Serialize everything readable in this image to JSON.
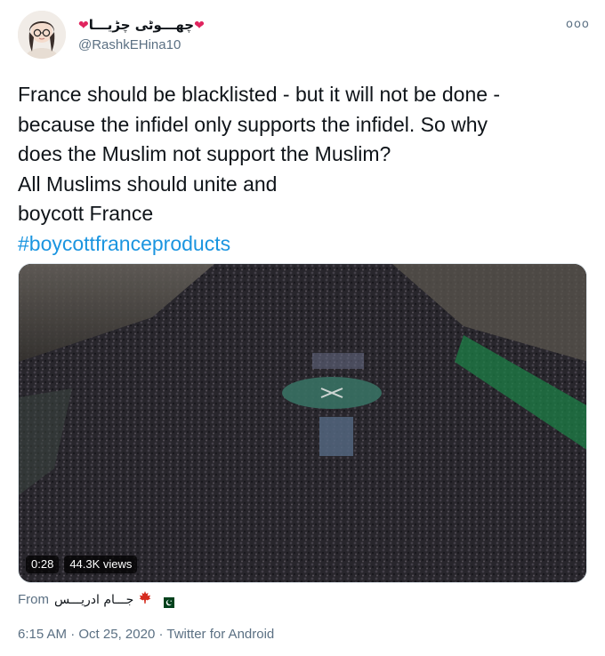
{
  "author": {
    "display_name": "چھـــوٹی چڑیـــا",
    "heart_left": "❤",
    "heart_right": "❤",
    "handle": "@RashkEHina10"
  },
  "more_label": "ooo",
  "tweet": {
    "lines": [
      "France should be blacklisted - but it will not be done -",
      "because the infidel only supports the infidel. So why",
      "does the Muslim not support the Muslim?",
      "All Muslims should unite and",
      "boycott France"
    ],
    "hashtag": "#boycottfranceproducts"
  },
  "media": {
    "duration": "0:28",
    "views": "44.3K views"
  },
  "from": {
    "label": "From",
    "source_name": "جـــام ادریـــس",
    "leaf_icon": "maple-leaf-icon",
    "flag_icon": "pakistan-flag-icon"
  },
  "meta": {
    "time": "6:15 AM",
    "separator": "·",
    "date": "Oct 25, 2020",
    "client": "Twitter for Android"
  },
  "colors": {
    "link": "#1b95e0",
    "secondary": "#5b7083",
    "heart": "#e0245e"
  }
}
